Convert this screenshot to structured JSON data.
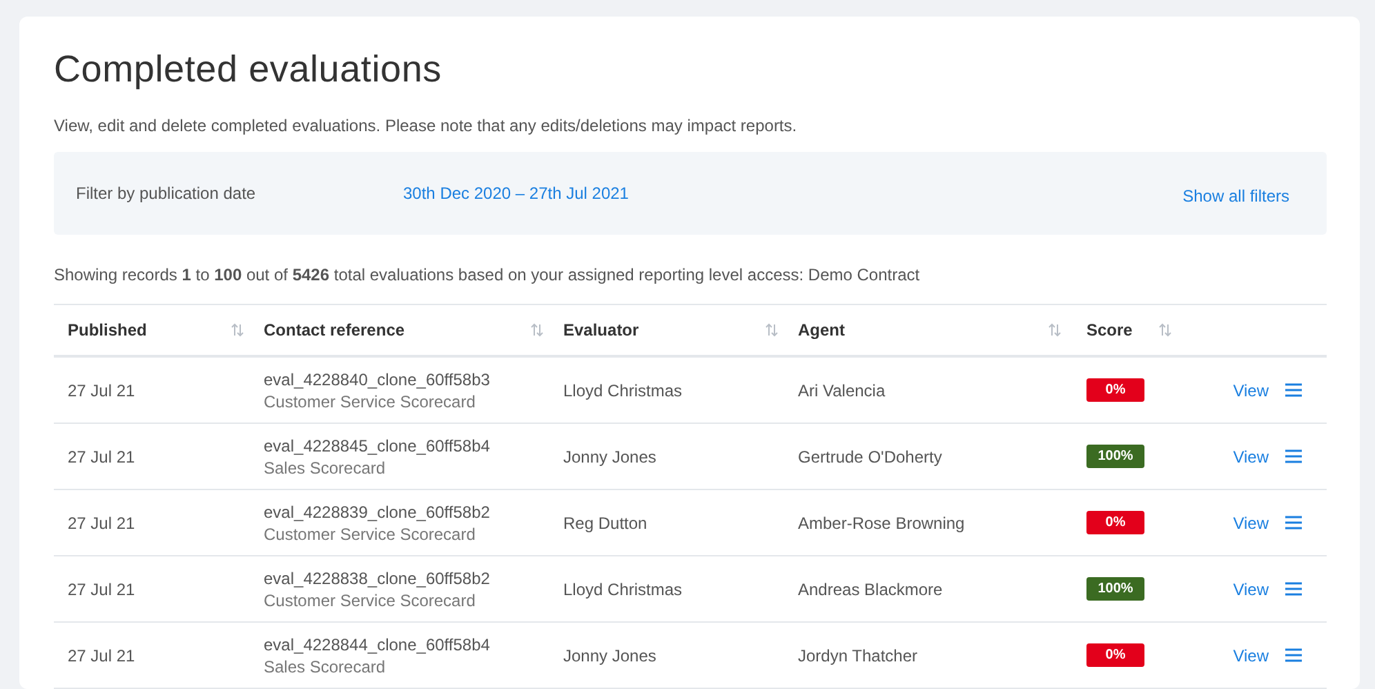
{
  "title": "Completed evaluations",
  "description": "View, edit and delete completed evaluations. Please note that any edits/deletions may impact reports.",
  "filter": {
    "label": "Filter by publication date",
    "value": "30th Dec 2020 – 27th Jul 2021",
    "toggle": "Show all filters"
  },
  "summary": "Showing records **1** to **100** out of **5426** total evaluations based on your assigned reporting level access: Demo Contract",
  "table": {
    "columns": [
      {
        "label": "Published",
        "sortable": true
      },
      {
        "label": "Contact reference",
        "sortable": true
      },
      {
        "label": "Evaluator",
        "sortable": true
      },
      {
        "label": "Agent",
        "sortable": true
      },
      {
        "label": "Score",
        "sortable": true
      }
    ],
    "rows": [
      {
        "published": "27 Jul 21",
        "reference": "eval_4228840_clone_60ff58b3",
        "scorecard": "Customer Service Scorecard",
        "evaluator": "Lloyd Christmas",
        "agent": "Ari Valencia",
        "score": "0%",
        "color": "#e3001b",
        "action": "View"
      },
      {
        "published": "27 Jul 21",
        "reference": "eval_4228845_clone_60ff58b4",
        "scorecard": "Sales Scorecard",
        "evaluator": "Jonny Jones",
        "agent": "Gertrude O'Doherty",
        "score": "100%",
        "color": "#3b6b22",
        "action": "View"
      },
      {
        "published": "27 Jul 21",
        "reference": "eval_4228839_clone_60ff58b2",
        "scorecard": "Customer Service Scorecard",
        "evaluator": "Reg Dutton",
        "agent": "Amber-Rose Browning",
        "score": "0%",
        "color": "#e3001b",
        "action": "View"
      },
      {
        "published": "27 Jul 21",
        "reference": "eval_4228838_clone_60ff58b2",
        "scorecard": "Customer Service Scorecard",
        "evaluator": "Lloyd Christmas",
        "agent": "Andreas Blackmore",
        "score": "100%",
        "color": "#3b6b22",
        "action": "View"
      },
      {
        "published": "27 Jul 21",
        "reference": "eval_4228844_clone_60ff58b4",
        "scorecard": "Sales Scorecard",
        "evaluator": "Jonny Jones",
        "agent": "Jordyn Thatcher",
        "score": "0%",
        "color": "#e3001b",
        "action": "View"
      }
    ]
  }
}
